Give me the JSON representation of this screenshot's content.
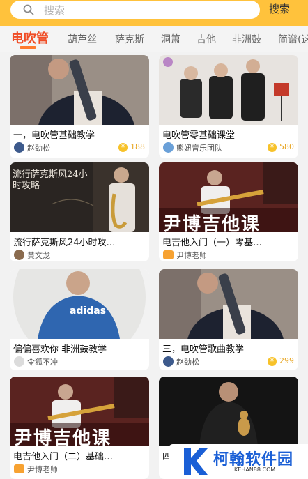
{
  "search": {
    "placeholder": "搜索",
    "button_label": "搜索"
  },
  "tabs": [
    {
      "label": "电吹管",
      "active": true
    },
    {
      "label": "葫芦丝"
    },
    {
      "label": "萨克斯"
    },
    {
      "label": "洞箫"
    },
    {
      "label": "吉他"
    },
    {
      "label": "非洲鼓"
    },
    {
      "label": "简谱(这"
    }
  ],
  "cards": [
    {
      "title": "一，电吹管基础教学",
      "author": "赵劲松",
      "coins": "188"
    },
    {
      "title": "电吹管零基础课堂",
      "author": "熊妞音乐团队",
      "coins": "580"
    },
    {
      "title": "流行萨克斯风24小时攻…",
      "author": "黄文龙",
      "thumb_text": "流行萨克斯风24小时攻略"
    },
    {
      "title": "电吉他入门（一）零基…",
      "author": "尹博老师",
      "thumb_text": "尹博吉他课"
    },
    {
      "title": "偏偏喜欢你 非洲鼓教学",
      "author": "令狐不冲",
      "thumb_text": "adidas"
    },
    {
      "title": "三，电吹管歌曲教学",
      "author": "赵劲松",
      "coins": "299"
    },
    {
      "title": "电吉他入门（二）基础…",
      "author": "尹博老师",
      "thumb_text": "尹博吉他课"
    },
    {
      "title": "四"
    }
  ],
  "watermark": {
    "name": "柯翰软件园",
    "url": "KEHAN88.COM"
  },
  "colors": {
    "accent": "#ffc23c",
    "active_tab": "#f04d26",
    "coin": "#e7a41f",
    "brand_blue": "#1a5fd6"
  }
}
